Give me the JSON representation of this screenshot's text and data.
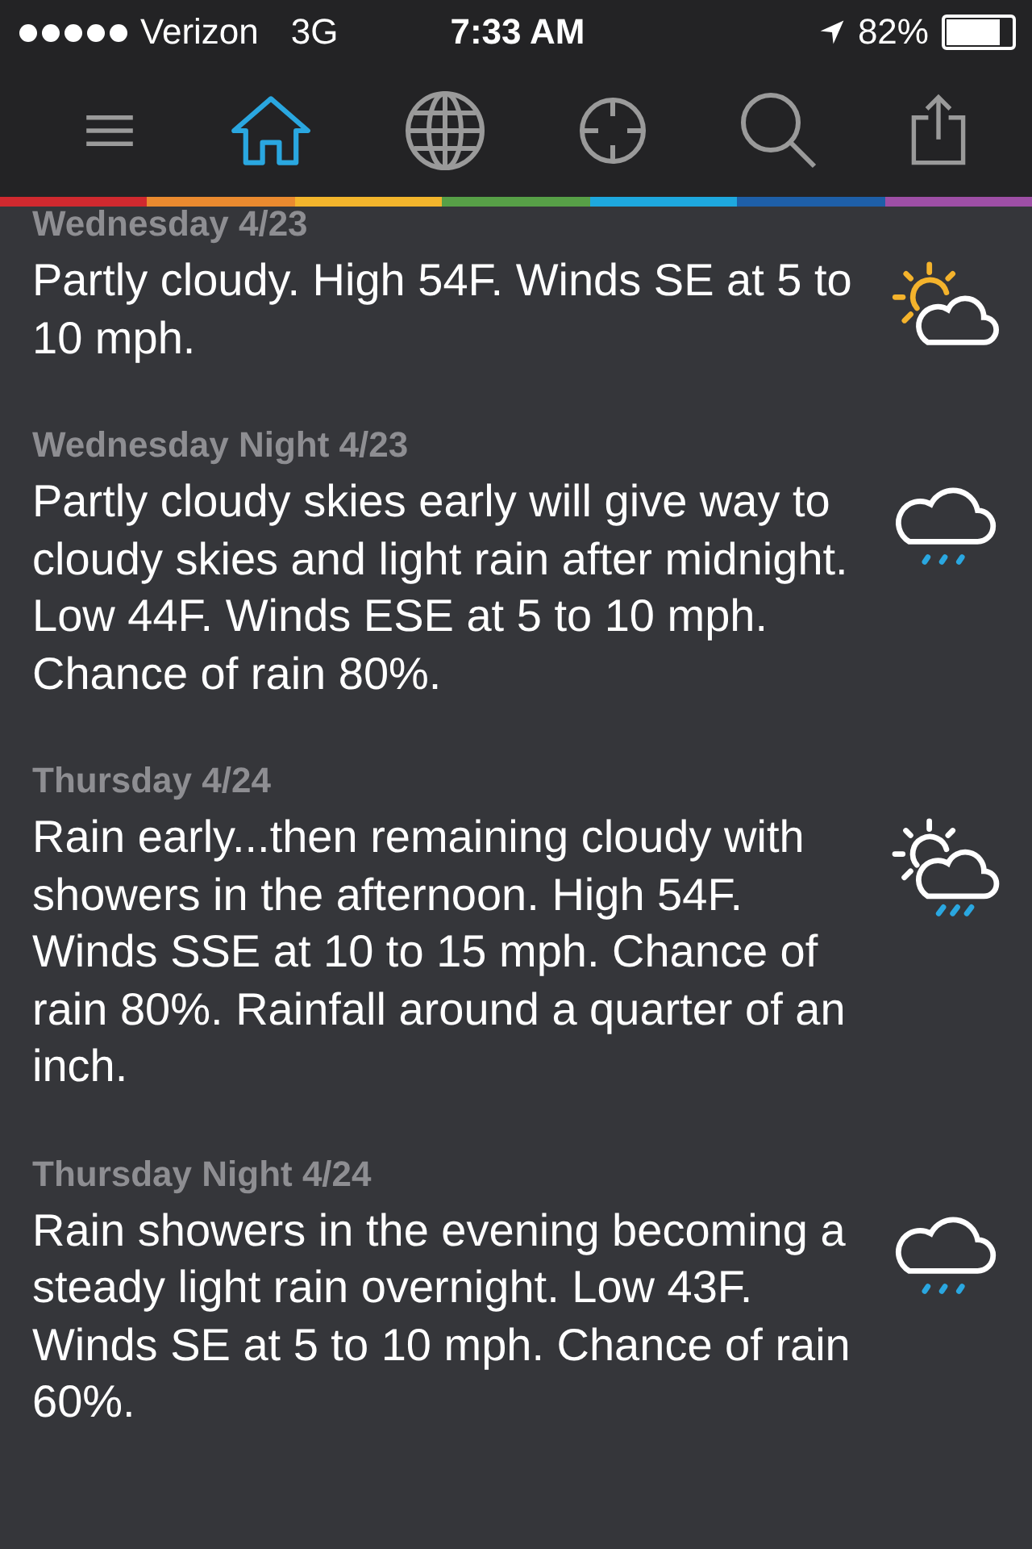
{
  "status_bar": {
    "carrier": "Verizon",
    "network": "3G",
    "time": "7:33 AM",
    "battery": "82%"
  },
  "toolbar": [
    {
      "kind": "menu",
      "selected": false
    },
    {
      "kind": "home",
      "selected": true
    },
    {
      "kind": "globe",
      "selected": false
    },
    {
      "kind": "locate",
      "selected": false
    },
    {
      "kind": "search",
      "selected": false
    },
    {
      "kind": "share",
      "selected": false
    }
  ],
  "forecast": [
    {
      "period": "Wednesday 4/23",
      "text": "Partly cloudy. High 54F. Winds SE at 5 to 10 mph.",
      "kind": "sun-cloud"
    },
    {
      "period": "Wednesday Night 4/23",
      "text": "Partly cloudy skies early will give way to cloudy skies and light rain after midnight. Low 44F. Winds ESE at 5 to 10 mph. Chance of rain 80%.",
      "kind": "rain"
    },
    {
      "period": "Thursday 4/24",
      "text": "Rain early...then remaining cloudy with showers in the afternoon. High 54F. Winds SSE at 10 to 15 mph. Chance of rain 80%. Rainfall around a quarter of an inch.",
      "kind": "showers"
    },
    {
      "period": "Thursday Night 4/24",
      "text": "Rain showers in the evening becoming a steady light rain overnight. Low 43F. Winds SE at 5 to 10 mph. Chance of rain 60%.",
      "kind": "rain"
    }
  ]
}
